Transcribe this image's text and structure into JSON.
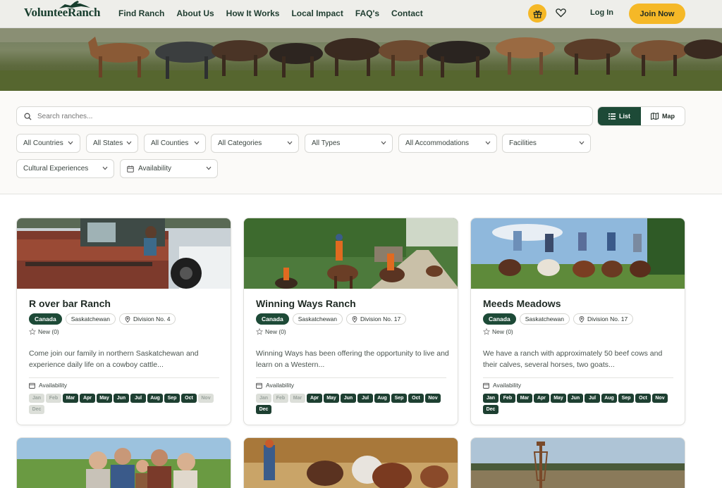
{
  "brand": {
    "logo_text_1": "Voluntee",
    "logo_text_2": "Ranch"
  },
  "nav": [
    {
      "label": "Find Ranch"
    },
    {
      "label": "About Us"
    },
    {
      "label": "How It Works"
    },
    {
      "label": "Local Impact"
    },
    {
      "label": "FAQ's"
    },
    {
      "label": "Contact"
    }
  ],
  "header": {
    "login_label": "Log In",
    "join_label": "Join Now",
    "gift_icon": "gift-icon",
    "heart_icon": "heart-icon"
  },
  "search": {
    "placeholder": "Search ranches...",
    "value": ""
  },
  "view_toggle": {
    "list_label": "List",
    "map_label": "Map",
    "selected": "List"
  },
  "filters": [
    {
      "label": "All Countries"
    },
    {
      "label": "All States"
    },
    {
      "label": "All Counties"
    },
    {
      "label": "All Categories"
    },
    {
      "label": "All Types"
    },
    {
      "label": "All Accommodations"
    },
    {
      "label": "Facilities"
    },
    {
      "label": "Cultural Experiences"
    },
    {
      "label": "Availability"
    }
  ],
  "colors": {
    "accent": "#f5b827",
    "brand_green": "#1d4a37",
    "month_inactive": "#dcdfd9"
  },
  "cards": [
    {
      "title": "R over bar Ranch",
      "country": "Canada",
      "state": "Saskatchewan",
      "division": "Division No. 4",
      "rating": "New (0)",
      "description": "Come join our family in northern Saskatchewan and experience daily life on a cowboy cattle...",
      "availability_label": "Availability",
      "months": [
        {
          "m": "Jan",
          "on": false
        },
        {
          "m": "Feb",
          "on": false
        },
        {
          "m": "Mar",
          "on": true
        },
        {
          "m": "Apr",
          "on": true
        },
        {
          "m": "May",
          "on": true
        },
        {
          "m": "Jun",
          "on": true
        },
        {
          "m": "Jul",
          "on": true
        },
        {
          "m": "Aug",
          "on": true
        },
        {
          "m": "Sep",
          "on": true
        },
        {
          "m": "Oct",
          "on": true
        },
        {
          "m": "Nov",
          "on": false
        },
        {
          "m": "Dec",
          "on": false
        }
      ]
    },
    {
      "title": "Winning Ways Ranch",
      "country": "Canada",
      "state": "Saskatchewan",
      "division": "Division No. 17",
      "rating": "New (0)",
      "description": "Winning Ways has been offering the opportunity to live and learn on a Western...",
      "availability_label": "Availability",
      "months": [
        {
          "m": "Jan",
          "on": false
        },
        {
          "m": "Feb",
          "on": false
        },
        {
          "m": "Mar",
          "on": false
        },
        {
          "m": "Apr",
          "on": true
        },
        {
          "m": "May",
          "on": true
        },
        {
          "m": "Jun",
          "on": true
        },
        {
          "m": "Jul",
          "on": true
        },
        {
          "m": "Aug",
          "on": true
        },
        {
          "m": "Sep",
          "on": true
        },
        {
          "m": "Oct",
          "on": true
        },
        {
          "m": "Nov",
          "on": true
        },
        {
          "m": "Dec",
          "on": true
        }
      ]
    },
    {
      "title": "Meeds Meadows",
      "country": "Canada",
      "state": "Saskatchewan",
      "division": "Division No. 17",
      "rating": "New (0)",
      "description": "We have a ranch with approximately 50 beef cows and their calves, several horses, two goats...",
      "availability_label": "Availability",
      "months": [
        {
          "m": "Jan",
          "on": true
        },
        {
          "m": "Feb",
          "on": true
        },
        {
          "m": "Mar",
          "on": true
        },
        {
          "m": "Apr",
          "on": true
        },
        {
          "m": "May",
          "on": true
        },
        {
          "m": "Jun",
          "on": true
        },
        {
          "m": "Jul",
          "on": true
        },
        {
          "m": "Aug",
          "on": true
        },
        {
          "m": "Sep",
          "on": true
        },
        {
          "m": "Oct",
          "on": true
        },
        {
          "m": "Nov",
          "on": true
        },
        {
          "m": "Dec",
          "on": true
        }
      ]
    }
  ]
}
